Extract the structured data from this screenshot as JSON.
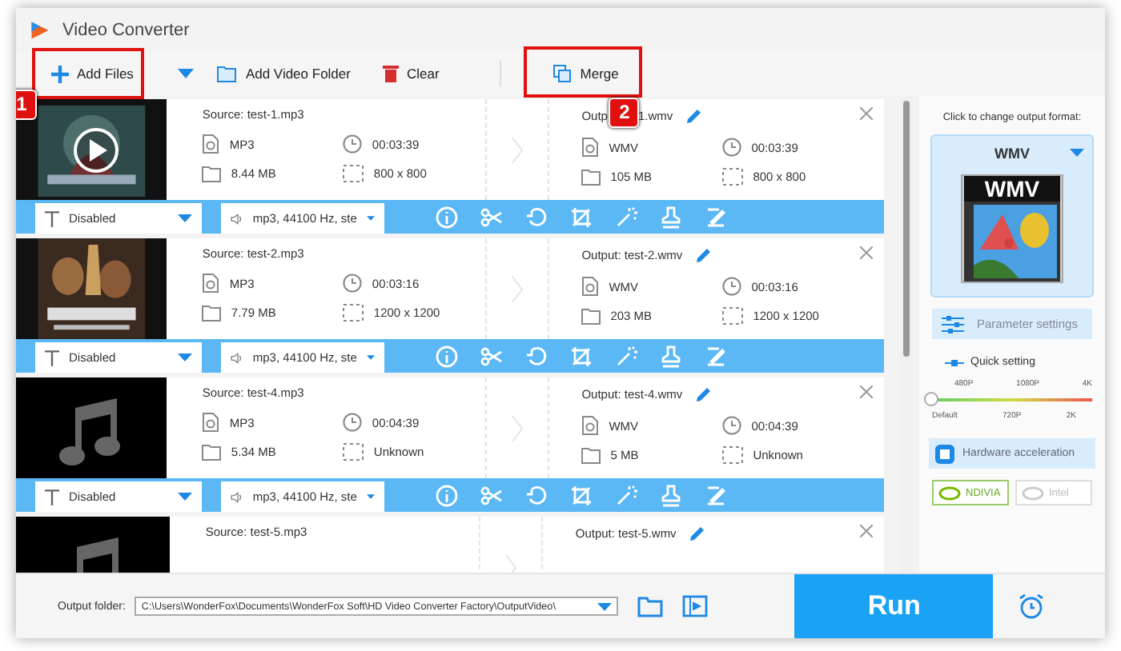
{
  "window": {
    "title": "Video Converter"
  },
  "toolbar": {
    "add_files": "Add Files",
    "add_folder": "Add Video Folder",
    "clear": "Clear",
    "merge": "Merge"
  },
  "callouts": [
    {
      "label": "1"
    },
    {
      "label": "2"
    }
  ],
  "items": [
    {
      "thumbnail": {
        "kind": "picture",
        "play_overlay": true
      },
      "source": "Source: test-1.mp3",
      "output": "Outp",
      "output_after_badge": "1.wmv",
      "src_format": "MP3",
      "src_duration": "00:03:39",
      "src_size": "8.44 MB",
      "src_resolution": "800 x 800",
      "out_format": "WMV",
      "out_duration": "00:03:39",
      "out_size": "105 MB",
      "out_resolution": "800 x 800",
      "subtitle": "Disabled",
      "audio": "mp3, 44100 Hz, ste"
    },
    {
      "thumbnail": {
        "kind": "picture",
        "play_overlay": false
      },
      "output": "Output: test-2.wmv",
      "source": "Source: test-2.mp3",
      "src_format": "MP3",
      "src_duration": "00:03:16",
      "src_size": "7.79 MB",
      "src_resolution": "1200 x 1200",
      "out_format": "WMV",
      "out_duration": "00:03:16",
      "out_size": "203 MB",
      "out_resolution": "1200 x 1200",
      "subtitle": "Disabled",
      "audio": "mp3, 44100 Hz, ste"
    },
    {
      "thumbnail": {
        "kind": "music",
        "play_overlay": false
      },
      "source": "Source: test-4.mp3",
      "output": "Output: test-4.wmv",
      "src_format": "MP3",
      "src_duration": "00:04:39",
      "src_size": "5.34 MB",
      "src_resolution": "Unknown",
      "out_format": "WMV",
      "out_duration": "00:04:39",
      "out_size": "5 MB",
      "out_resolution": "Unknown",
      "subtitle": "Disabled",
      "audio": "mp3, 44100 Hz, ste"
    },
    {
      "thumbnail": {
        "kind": "music",
        "play_overlay": false
      },
      "source": "Source: test-5.mp3",
      "output": "Output: test-5.wmv"
    }
  ],
  "format_panel": {
    "hint": "Click to change output format:",
    "format": "WMV",
    "icon_label": "WMV",
    "parameter_settings": "Parameter settings",
    "quick_setting": "Quick setting",
    "quality": {
      "level": 0,
      "top_ticks": [
        "480P",
        "1080P",
        "4K"
      ],
      "bottom_ticks": [
        "Default",
        "720P",
        "2K"
      ]
    },
    "hardware_acceleration": "Hardware acceleration",
    "accelerators": [
      {
        "label": "NDIVIA",
        "on": true
      },
      {
        "label": "Intel",
        "on": false
      }
    ]
  },
  "bottom_bar": {
    "output_folder_label": "Output folder:",
    "output_folder": "C:\\Users\\WonderFox\\Documents\\WonderFox Soft\\HD Video Converter Factory\\OutputVideo\\",
    "run": "Run"
  }
}
